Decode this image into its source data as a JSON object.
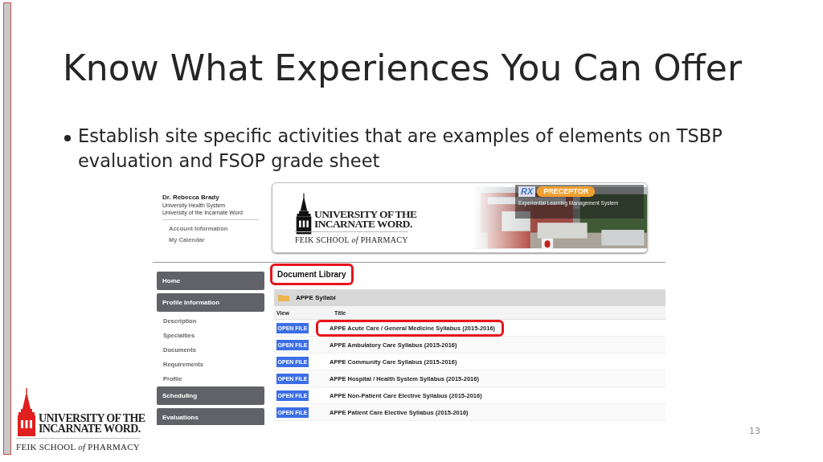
{
  "slide": {
    "title": "Know What Experiences You Can Offer",
    "bullets": [
      "Establish site specific activities that are examples of elements on TSBP evaluation and FSOP grade sheet"
    ],
    "page_number": "13"
  },
  "footer_logo": {
    "line1": "UNIVERSITY OF THE",
    "line2": "INCARNATE WORD.",
    "line3": "FEIK SCHOOL *of* PHARMACY"
  },
  "screenshot": {
    "user": {
      "name": "Dr. Rebecca Brady",
      "lines": [
        "University Health System",
        "University of the Incarnate Word"
      ],
      "links": [
        "Account Information",
        "My Calendar"
      ]
    },
    "banner": {
      "logo": {
        "line1": "UNIVERSITY OF THE",
        "line2": "INCARNATE WORD.",
        "line3": "FEIK SCHOOL *of* PHARMACY"
      },
      "badge": {
        "mark": "RX",
        "name": "PRECEPTOR",
        "tagline": "Experiential Learning Management System"
      }
    },
    "sidebar": [
      {
        "kind": "section",
        "label": "Home"
      },
      {
        "kind": "section",
        "label": "Profile Information"
      },
      {
        "kind": "link",
        "label": "Description"
      },
      {
        "kind": "link",
        "label": "Specialties"
      },
      {
        "kind": "link",
        "label": "Documents"
      },
      {
        "kind": "link",
        "label": "Requirements"
      },
      {
        "kind": "link",
        "label": "Profile"
      },
      {
        "kind": "section",
        "label": "Scheduling"
      },
      {
        "kind": "section",
        "label": "Evaluations"
      }
    ],
    "library": {
      "heading": "Document Library",
      "highlighted": true,
      "folder": "APPE Syllabi",
      "columns": [
        "View",
        "Title"
      ],
      "rows": [
        {
          "button": "OPEN FILE",
          "title": "APPE Acute Care / General Medicine Syllabus (2015-2016)",
          "highlighted": true
        },
        {
          "button": "OPEN FILE",
          "title": "APPE Ambulatory Care Syllabus (2015-2016)",
          "highlighted": false
        },
        {
          "button": "OPEN FILE",
          "title": "APPE Community Care Syllabus (2015-2016)",
          "highlighted": false
        },
        {
          "button": "OPEN FILE",
          "title": "APPE Hospital / Health System Syllabus (2015-2016)",
          "highlighted": false
        },
        {
          "button": "OPEN FILE",
          "title": "APPE Non-Patient Care Elective Syllabus (2015-2016)",
          "highlighted": false
        },
        {
          "button": "OPEN FILE",
          "title": "APPE Patient Care Elective Syllabus (2015-2016)",
          "highlighted": false
        }
      ]
    }
  }
}
